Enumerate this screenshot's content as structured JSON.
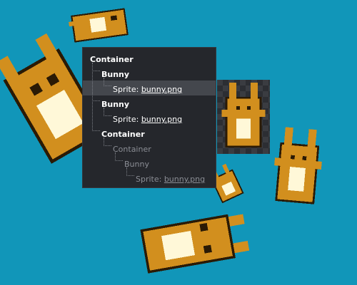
{
  "colors": {
    "background": "#1196b9",
    "panel": "#25272c",
    "selection": "#44474d"
  },
  "tree": {
    "nodes": [
      {
        "kind": "Container",
        "active": true
      },
      {
        "kind": "Bunny",
        "active": true
      },
      {
        "kind": "Sprite",
        "sep": ": ",
        "texture": "bunny.png",
        "active": true,
        "selected": true
      },
      {
        "kind": "Bunny",
        "active": true
      },
      {
        "kind": "Sprite",
        "sep": ": ",
        "texture": "bunny.png",
        "active": true
      },
      {
        "kind": "Container",
        "active": true
      },
      {
        "kind": "Container",
        "active": false
      },
      {
        "kind": "Bunny",
        "active": false
      },
      {
        "kind": "Sprite",
        "sep": ": ",
        "texture": "bunny.png",
        "active": false
      }
    ]
  },
  "preview": {
    "sprite_icon": "bunny-sprite-icon"
  }
}
